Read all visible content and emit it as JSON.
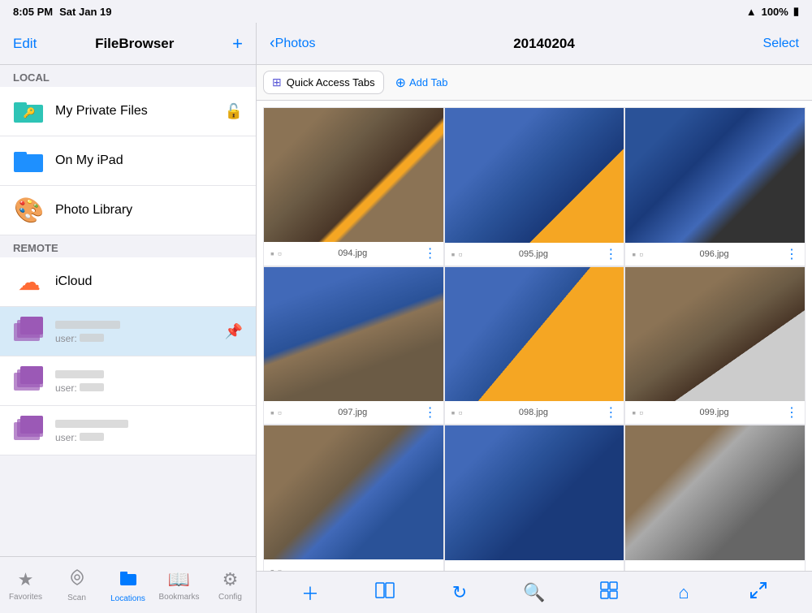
{
  "status_bar": {
    "time": "8:05 PM",
    "date": "Sat Jan 19",
    "wifi": "WiFi",
    "battery": "100%"
  },
  "sidebar": {
    "header": {
      "edit_label": "Edit",
      "title": "FileBrowser",
      "add_label": "+"
    },
    "local_section": "Local",
    "remote_section": "Remote",
    "items": [
      {
        "id": "my-private-files",
        "label": "My Private Files",
        "icon": "folder-lock",
        "has_lock": true
      },
      {
        "id": "on-my-ipad",
        "label": "On My iPad",
        "icon": "folder"
      },
      {
        "id": "photo-library",
        "label": "Photo Library",
        "icon": "photo"
      }
    ],
    "remote_items": [
      {
        "id": "icloud",
        "label": "iCloud",
        "icon": "cloud"
      },
      {
        "id": "net1",
        "label": "[redacted]",
        "sub": "user: [redacted]",
        "icon": "net-folder",
        "active": true
      },
      {
        "id": "net2",
        "label": "[redacted]",
        "sub": "user: [redacted]",
        "icon": "net-folder"
      },
      {
        "id": "net3",
        "label": "[redacted]",
        "sub": "user: [redacted]",
        "icon": "net-folder"
      }
    ]
  },
  "bottom_nav": {
    "items": [
      {
        "id": "favorites",
        "label": "Favorites",
        "icon": "★",
        "active": false
      },
      {
        "id": "scan",
        "label": "Scan",
        "icon": "wifi-scan",
        "active": false
      },
      {
        "id": "locations",
        "label": "Locations",
        "icon": "folder-open",
        "active": true
      },
      {
        "id": "bookmarks",
        "label": "Bookmarks",
        "icon": "book",
        "active": false
      },
      {
        "id": "config",
        "label": "Config",
        "icon": "gear",
        "active": false
      }
    ]
  },
  "right_panel": {
    "back_label": "Photos",
    "title": "20140204",
    "select_label": "Select",
    "quick_access": {
      "tab_label": "Quick Access Tabs",
      "add_label": "Add Tab"
    },
    "photos": [
      {
        "id": "094",
        "filename": "094.jpg"
      },
      {
        "id": "095",
        "filename": "095.jpg"
      },
      {
        "id": "096",
        "filename": "096.jpg"
      },
      {
        "id": "097",
        "filename": "097.jpg"
      },
      {
        "id": "098",
        "filename": "098.jpg"
      },
      {
        "id": "099",
        "filename": "099.jpg"
      },
      {
        "id": "100",
        "filename": ""
      },
      {
        "id": "101",
        "filename": ""
      },
      {
        "id": "102",
        "filename": ""
      }
    ],
    "toolbar": {
      "add": "+",
      "columns": "columns",
      "refresh": "refresh",
      "search": "search",
      "grid": "grid",
      "home": "home",
      "expand": "expand"
    }
  }
}
